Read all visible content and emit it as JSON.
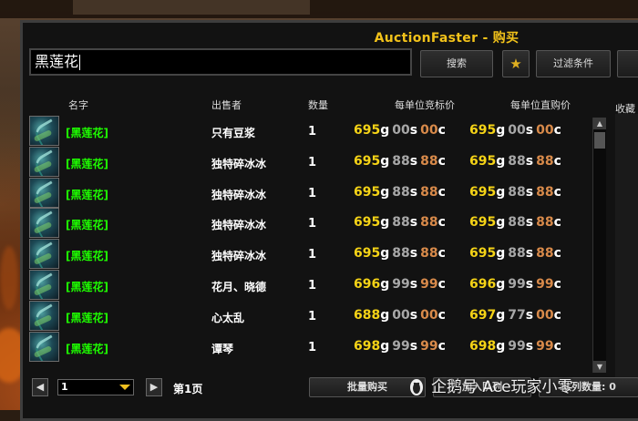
{
  "window": {
    "title": "AuctionFaster - 购买"
  },
  "search": {
    "value": "黑莲花",
    "button_label": "搜索",
    "filter_label": "过滤条件",
    "star_icon": "star-icon"
  },
  "columns": {
    "name": "名字",
    "seller": "出售者",
    "qty": "数量",
    "bid": "每单位竞标价",
    "buyout": "每单位直购价"
  },
  "favorites_label": "收藏",
  "rows": [
    {
      "name": "[黑莲花]",
      "seller": "只有豆浆",
      "qty": "1",
      "bid": {
        "g": "695",
        "s": "00",
        "c": "00"
      },
      "buy": {
        "g": "695",
        "s": "00",
        "c": "00"
      }
    },
    {
      "name": "[黑莲花]",
      "seller": "独特碎冰冰",
      "qty": "1",
      "bid": {
        "g": "695",
        "s": "88",
        "c": "88"
      },
      "buy": {
        "g": "695",
        "s": "88",
        "c": "88"
      }
    },
    {
      "name": "[黑莲花]",
      "seller": "独特碎冰冰",
      "qty": "1",
      "bid": {
        "g": "695",
        "s": "88",
        "c": "88"
      },
      "buy": {
        "g": "695",
        "s": "88",
        "c": "88"
      }
    },
    {
      "name": "[黑莲花]",
      "seller": "独特碎冰冰",
      "qty": "1",
      "bid": {
        "g": "695",
        "s": "88",
        "c": "88"
      },
      "buy": {
        "g": "695",
        "s": "88",
        "c": "88"
      }
    },
    {
      "name": "[黑莲花]",
      "seller": "独特碎冰冰",
      "qty": "1",
      "bid": {
        "g": "695",
        "s": "88",
        "c": "88"
      },
      "buy": {
        "g": "695",
        "s": "88",
        "c": "88"
      }
    },
    {
      "name": "[黑莲花]",
      "seller": "花月、晓德",
      "qty": "1",
      "bid": {
        "g": "696",
        "s": "99",
        "c": "99"
      },
      "buy": {
        "g": "696",
        "s": "99",
        "c": "99"
      }
    },
    {
      "name": "[黑莲花]",
      "seller": "心太乱",
      "qty": "1",
      "bid": {
        "g": "688",
        "s": "00",
        "c": "00"
      },
      "buy": {
        "g": "697",
        "s": "77",
        "c": "00"
      }
    },
    {
      "name": "[黑莲花]",
      "seller": "谭琴",
      "qty": "1",
      "bid": {
        "g": "698",
        "s": "99",
        "c": "99"
      },
      "buy": {
        "g": "698",
        "s": "99",
        "c": "99"
      }
    }
  ],
  "currency": {
    "g": "g",
    "s": "s",
    "c": "c"
  },
  "pagination": {
    "selected": "1",
    "page_label": "第1页",
    "prev_icon": "arrow-left-icon",
    "next_icon": "arrow-right-icon"
  },
  "actions": {
    "bulk_buy": "批量购买",
    "add_queue": "加入队列",
    "queue_count": "队列数量: 0"
  },
  "watermark": "企鹅号 Ace玩家小零",
  "colors": {
    "accent": "#f2c21a",
    "item_green": "#1eff00",
    "gold": "#f5d316",
    "silver": "#a8a8a8",
    "copper": "#d88a4a"
  }
}
